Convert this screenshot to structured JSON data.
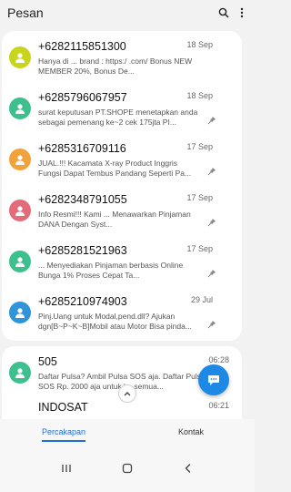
{
  "app": {
    "title": "Pesan"
  },
  "header": {
    "search_icon": "search-icon",
    "more_icon": "more-vertical-icon"
  },
  "conversations": [
    {
      "sender": "+6282115851300",
      "date": "18 Sep",
      "preview": "Hanya di ... brand : https:/ .com/ Bonus NEW MEMBER 20%, Bonus De...",
      "avatar_color": "#c9d41c"
    },
    {
      "sender": "+6285796067957",
      "date": "18 Sep",
      "preview": "surat keputusan PT.SHOPE menetapkan anda sebagai pemenang ke~2 cek 175jta PI...",
      "avatar_color": "#3dbf8e"
    },
    {
      "sender": "+6285316709116",
      "date": "17 Sep",
      "preview": "JUAL.!!! Kacamata X-ray Product Inggris Fungsi Dapat Tembus Pandang Seperti Pa...",
      "avatar_color": "#f2a23a"
    },
    {
      "sender": "+6282348791055",
      "date": "17 Sep",
      "preview": "Info Resmi!!! Kami ... Menawarkan Pinjaman DANA Dengan Syst...",
      "avatar_color": "#e36b7a"
    },
    {
      "sender": "+6285281521963",
      "date": "17 Sep",
      "preview": "... Menyediakan Pinjaman berbasis Online Bunga 1% Proses Cepat Ta...",
      "avatar_color": "#3dbf8e"
    },
    {
      "sender": "+6285210974903",
      "date": "29 Jul",
      "preview": "Pinj.Uang untuk Modal,pend.dll? Ajukan dgn[B~P~K~B]Mobil atau Motor Bisa pinda...",
      "avatar_color": "#2f94d8"
    }
  ],
  "lower_conversations": [
    {
      "sender": "505",
      "date": "06:28",
      "preview": "Daftar Pulsa? Ambil Pulsa SOS aja. Daftar Pulsa SOS Rp. 2000 aja untuk ke semua...",
      "avatar_color": "#3dbf8e"
    },
    {
      "sender": "INDOSAT",
      "date": "06:21",
      "preview": "",
      "avatar_color": "#3dbf8e"
    }
  ],
  "tabs": [
    {
      "label": "Percakapan",
      "active": true
    },
    {
      "label": "Kontak",
      "active": false
    }
  ],
  "accent_color": "#1e6fd6",
  "fab_color": "#1e88e5"
}
